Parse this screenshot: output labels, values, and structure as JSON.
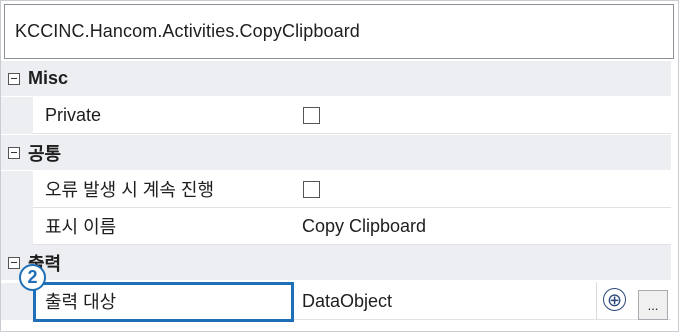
{
  "panel": {
    "title": "KCCINC.Hancom.Activities.CopyClipboard"
  },
  "categories": [
    {
      "label": "Misc",
      "properties": [
        {
          "name": "Private",
          "type": "checkbox",
          "checked": false
        }
      ]
    },
    {
      "label": "공통",
      "properties": [
        {
          "name": "오류 발생 시 계속 진행",
          "type": "checkbox",
          "checked": false
        },
        {
          "name": "표시 이름",
          "type": "text",
          "value": "Copy Clipboard"
        }
      ]
    },
    {
      "label": "출력",
      "properties": [
        {
          "name": "출력 대상",
          "type": "text",
          "value": "DataObject"
        }
      ]
    }
  ],
  "annotation": {
    "step_number": "2"
  },
  "buttons": {
    "add_symbol": "⊕",
    "more_label": "..."
  },
  "colors": {
    "highlight": "#1f6fb8",
    "category_bg": "#eceef1"
  }
}
